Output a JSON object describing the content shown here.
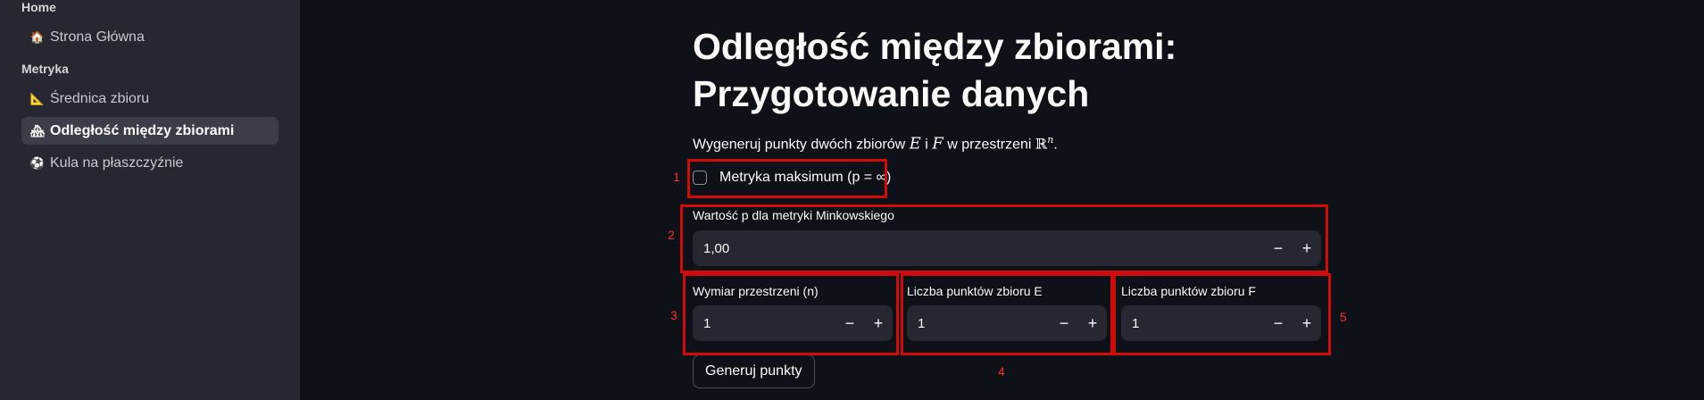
{
  "sidebar": {
    "section_home": "Home",
    "section_metric": "Metryka",
    "items": [
      {
        "label": "Strona Główna",
        "icon": "house-icon"
      },
      {
        "label": "Średnica zbioru",
        "icon": "triangle-ruler-icon"
      },
      {
        "label": "Odległość między zbiorami",
        "icon": "house-building-icon",
        "active": true
      },
      {
        "label": "Kula na płaszczyźnie",
        "icon": "soccer-ball-icon"
      }
    ]
  },
  "main": {
    "title_line1": "Odległość między zbiorami:",
    "title_line2": "Przygotowanie danych",
    "intro_prefix": "Wygeneruj punkty dwóch zbiorów",
    "intro_var_e": "E",
    "intro_and": "i",
    "intro_var_f": "F",
    "intro_mid": "w przestrzeni",
    "intro_space": "ℝ",
    "intro_exp": "n",
    "intro_end": ".",
    "checkbox_label": "Metryka maksimum (p = ∞)",
    "checkbox_checked": false,
    "p_field_label": "Wartość p dla metryki Minkowskiego",
    "p_value": "1,00",
    "dim_label": "Wymiar przestrzeni (n)",
    "dim_value": "1",
    "count_e_label": "Liczba punktów zbioru E",
    "count_e_value": "1",
    "count_f_label": "Liczba punktów zbioru F",
    "count_f_value": "1",
    "minus": "−",
    "plus": "+",
    "generate_button": "Generuj punkty"
  },
  "annotations": {
    "n1": "1",
    "n2": "2",
    "n3": "3",
    "n4": "4",
    "n5": "5",
    "color": "#d10a0a"
  },
  "colors": {
    "background": "#0e1117",
    "sidebar": "#262730",
    "input": "#262730"
  }
}
